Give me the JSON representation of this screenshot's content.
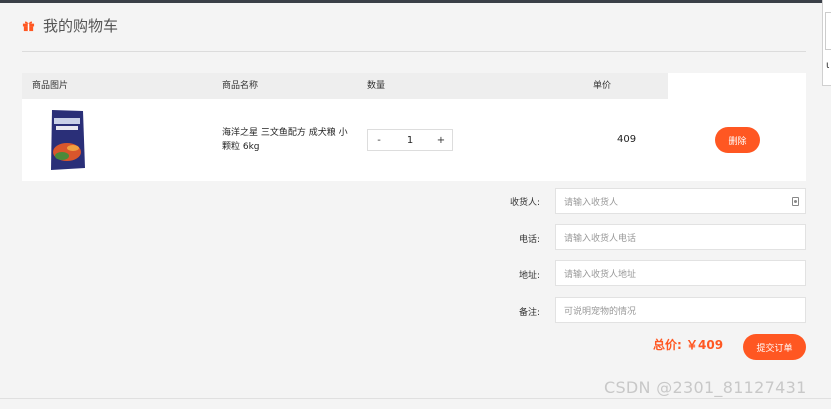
{
  "header": {
    "title": "我的购物车",
    "icon": "gift-icon",
    "accent": "#ff5722"
  },
  "table": {
    "columns": [
      "商品图片",
      "商品名称",
      "数量",
      "单价"
    ],
    "rows": [
      {
        "name": "海洋之星 三文鱼配方 成犬粮 小颗粒 6kg",
        "quantity": "1",
        "price": "409",
        "minus": "-",
        "plus": "+",
        "delete_label": "删除"
      }
    ]
  },
  "form": {
    "receiver": {
      "label": "收货人:",
      "placeholder": "请输入收货人"
    },
    "phone": {
      "label": "电话:",
      "placeholder": "请输入收货人电话"
    },
    "address": {
      "label": "地址:",
      "placeholder": "请输入收货人地址"
    },
    "note": {
      "label": "备注:",
      "placeholder": "可说明宠物的情况"
    }
  },
  "summary": {
    "total_label": "总价:",
    "total_value": "￥409",
    "submit_label": "提交订单"
  },
  "watermark": "CSDN @2301_81127431"
}
